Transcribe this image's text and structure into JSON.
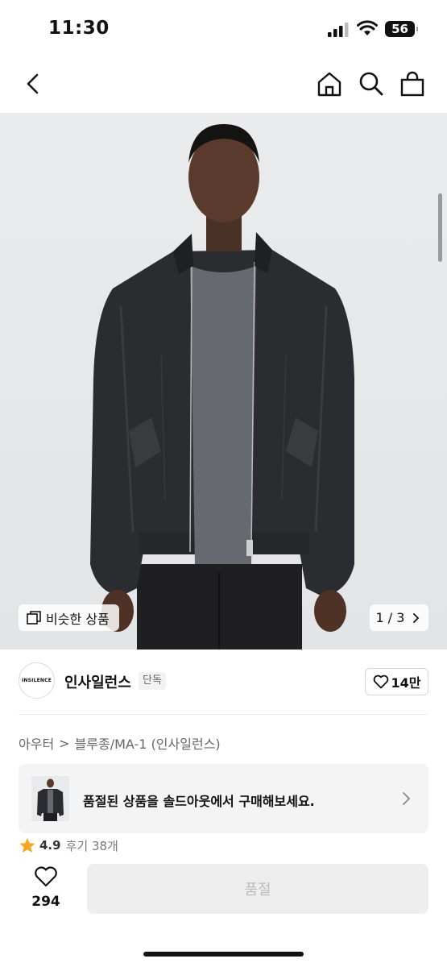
{
  "status_bar": {
    "time": "11:30",
    "battery": "56"
  },
  "hero": {
    "similar_label": "비슷한 상품",
    "pager": "1 / 3"
  },
  "brand": {
    "logo_text": "INSILENCE",
    "name": "인사일런스",
    "badge": "단독",
    "likes": "14만"
  },
  "breadcrumb": {
    "category": "아우터",
    "separator": ">",
    "subcategory": "블루종/MA-1 (인사일런스)"
  },
  "soldout_banner": {
    "message": "품절된 상품을 솔드아웃에서 구매해보세요."
  },
  "rating": {
    "score": "4.9",
    "reviews": "후기 38개"
  },
  "bottom": {
    "wish_count": "294",
    "buy_label": "품절"
  }
}
